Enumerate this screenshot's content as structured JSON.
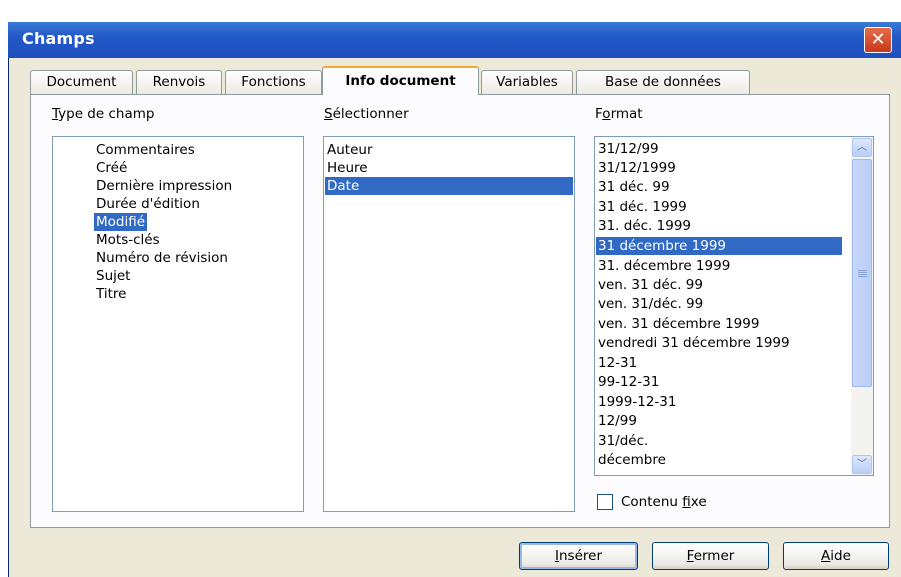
{
  "window": {
    "title": "Champs",
    "close_glyph": "✕"
  },
  "tabs": [
    {
      "label": "Document"
    },
    {
      "label": "Renvois"
    },
    {
      "label": "Fonctions"
    },
    {
      "label": "Info document"
    },
    {
      "label": "Variables"
    },
    {
      "label": "Base de données"
    }
  ],
  "type_de_champ": {
    "label_hot": "T",
    "label_rest": "ype de champ",
    "items": [
      "Commentaires",
      "Créé",
      "Dernière impression",
      "Durée d'édition",
      "Modifié",
      "Mots-clés",
      "Numéro de révision",
      "Sujet",
      "Titre"
    ],
    "selected": "Modifié"
  },
  "selectionner": {
    "label_hot": "S",
    "label_rest": "électionner",
    "items": [
      "Auteur",
      "Heure",
      "Date"
    ],
    "selected": "Date"
  },
  "format": {
    "label_pre": "F",
    "label_hot": "o",
    "label_rest": "rmat",
    "items": [
      "31/12/99",
      "31/12/1999",
      "31 déc. 99",
      "31 déc. 1999",
      "31. déc. 1999",
      "31 décembre 1999",
      "31. décembre 1999",
      "ven. 31 déc. 99",
      "ven. 31/déc. 99",
      "ven. 31 décembre 1999",
      "vendredi 31 décembre 1999",
      "12-31",
      "99-12-31",
      "1999-12-31",
      "12/99",
      "31/déc.",
      "décembre"
    ],
    "selected": "31 décembre 1999"
  },
  "contenu_fixe": {
    "label_pre": "Contenu ",
    "label_hot": "f",
    "label_rest": "ixe",
    "checked": false
  },
  "buttons": {
    "inserer": {
      "hot": "I",
      "rest": "nsérer"
    },
    "fermer": {
      "hot": "F",
      "rest": "ermer"
    },
    "aide": {
      "hot": "A",
      "rest": "ide"
    }
  },
  "colors": {
    "titlebar": "#2358c8",
    "selection": "#316ac5",
    "dialog_bg": "#ece9d8",
    "close": "#c9381c"
  }
}
